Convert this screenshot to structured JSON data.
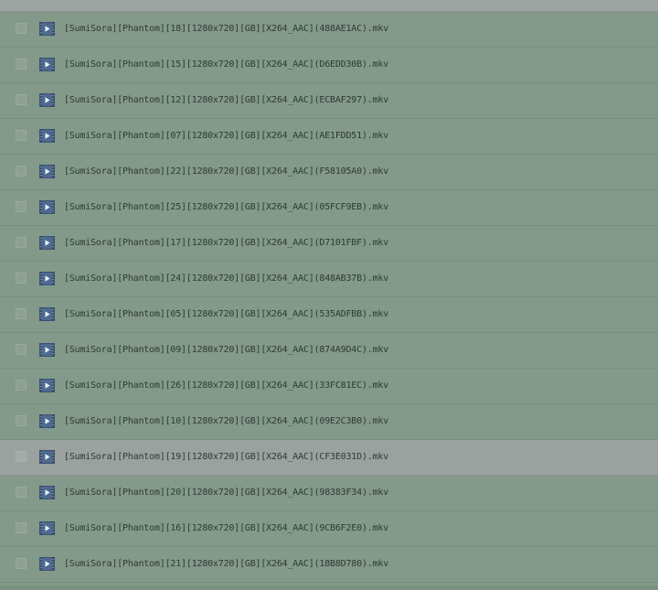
{
  "files": [
    {
      "name": "[SumiSora][Phantom][18][1280x720][GB][X264_AAC](488AE1AC).mkv",
      "icon": "video-file-icon",
      "selected": false
    },
    {
      "name": "[SumiSora][Phantom][15][1280x720][GB][X264_AAC](D6EDD30B).mkv",
      "icon": "video-file-icon",
      "selected": false
    },
    {
      "name": "[SumiSora][Phantom][12][1280x720][GB][X264_AAC](ECBAF297).mkv",
      "icon": "video-file-icon",
      "selected": false
    },
    {
      "name": "[SumiSora][Phantom][07][1280x720][GB][X264_AAC](AE1FDD51).mkv",
      "icon": "video-file-icon",
      "selected": false
    },
    {
      "name": "[SumiSora][Phantom][22][1280x720][GB][X264_AAC](F58105A0).mkv",
      "icon": "video-file-icon",
      "selected": false
    },
    {
      "name": "[SumiSora][Phantom][25][1280x720][GB][X264_AAC](05FCF9EB).mkv",
      "icon": "video-file-icon",
      "selected": false
    },
    {
      "name": "[SumiSora][Phantom][17][1280x720][GB][X264_AAC](D7101FBF).mkv",
      "icon": "video-file-icon",
      "selected": false
    },
    {
      "name": "[SumiSora][Phantom][24][1280x720][GB][X264_AAC](848AB37B).mkv",
      "icon": "video-file-icon",
      "selected": false
    },
    {
      "name": "[SumiSora][Phantom][05][1280x720][GB][X264_AAC](535ADFBB).mkv",
      "icon": "video-file-icon",
      "selected": false
    },
    {
      "name": "[SumiSora][Phantom][09][1280x720][GB][X264_AAC](874A9D4C).mkv",
      "icon": "video-file-icon",
      "selected": false
    },
    {
      "name": "[SumiSora][Phantom][26][1280x720][GB][X264_AAC](33FC81EC).mkv",
      "icon": "video-file-icon",
      "selected": false
    },
    {
      "name": "[SumiSora][Phantom][10][1280x720][GB][X264_AAC](09E2C3B0).mkv",
      "icon": "video-file-icon",
      "selected": false
    },
    {
      "name": "[SumiSora][Phantom][19][1280x720][GB][X264_AAC](CF3E031D).mkv",
      "icon": "video-file-icon",
      "selected": true
    },
    {
      "name": "[SumiSora][Phantom][20][1280x720][GB][X264_AAC](98383F34).mkv",
      "icon": "video-file-icon",
      "selected": false
    },
    {
      "name": "[SumiSora][Phantom][16][1280x720][GB][X264_AAC](9CB6F2E0).mkv",
      "icon": "video-file-icon",
      "selected": false
    },
    {
      "name": "[SumiSora][Phantom][21][1280x720][GB][X264_AAC](18B8D780).mkv",
      "icon": "video-file-icon",
      "selected": false
    }
  ],
  "colors": {
    "background": "#83998a",
    "selected_row": "#9aa19f",
    "icon_fill": "#4f6a8f",
    "text": "#2e3a34"
  }
}
